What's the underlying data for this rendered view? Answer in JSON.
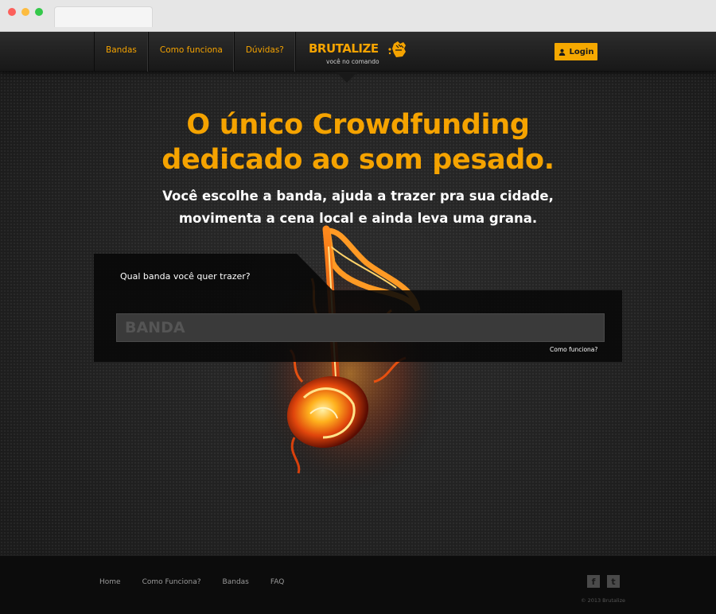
{
  "nav": {
    "items": [
      {
        "label": "Bandas"
      },
      {
        "label": "Como funciona"
      },
      {
        "label": "Dúvidas?"
      }
    ],
    "login_label": "Login"
  },
  "logo": {
    "name": "BRUTALIZE",
    "tagline": "você no comando"
  },
  "hero": {
    "headline_line1": "O único Crowdfunding",
    "headline_line2": "dedicado ao som pesado.",
    "subline_line1": "Você escolhe a banda, ajuda a trazer pra sua cidade,",
    "subline_line2": "movimenta a cena local e ainda leva uma grana."
  },
  "search": {
    "question": "Qual banda você quer trazer?",
    "placeholder": "BANDA",
    "value": "",
    "help_link": "Como funciona?"
  },
  "footer": {
    "links": [
      {
        "label": "Home"
      },
      {
        "label": "Como Funciona?"
      },
      {
        "label": "Bandas"
      },
      {
        "label": "FAQ"
      }
    ],
    "social": [
      {
        "icon": "facebook-icon",
        "glyph": "f"
      },
      {
        "icon": "twitter-icon",
        "glyph": "t"
      }
    ],
    "copyright": "© 2013 Brutalize"
  },
  "colors": {
    "accent": "#f5a300",
    "background": "#242424",
    "footer": "#0c0c0c"
  },
  "icons": {
    "login": "user-icon",
    "hero_image": "flaming-music-note-icon"
  }
}
